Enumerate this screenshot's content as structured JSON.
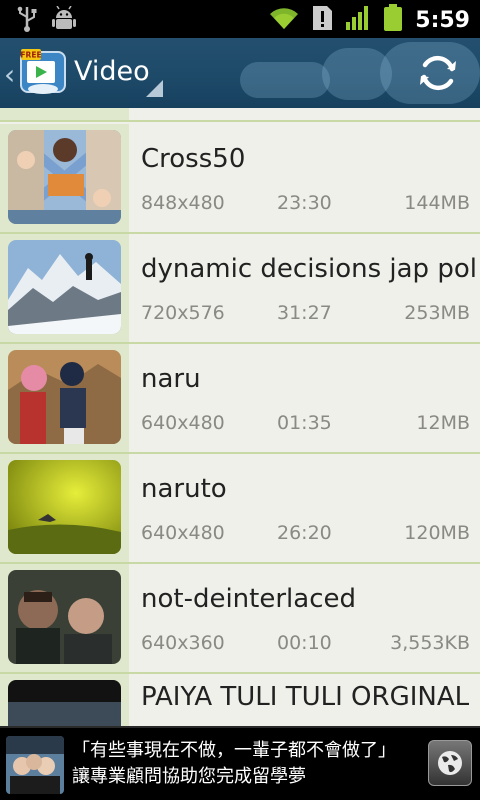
{
  "status_bar": {
    "time": "5:59",
    "icons": [
      "usb-icon",
      "android-debug-icon",
      "wifi-icon",
      "sd-card-alert-icon",
      "signal-icon",
      "battery-icon"
    ],
    "accent": "#9acd32"
  },
  "header": {
    "title": "Video",
    "app_icon": "free-video-app-icon",
    "app_icon_badge": "FREE",
    "refresh_icon": "refresh-icon",
    "background": "#1e4a69"
  },
  "videos": [
    {
      "name": "Cross50",
      "resolution": "848x480",
      "duration": "23:30",
      "size": "144MB"
    },
    {
      "name": "dynamic decisions jap pol",
      "resolution": "720x576",
      "duration": "31:27",
      "size": "253MB"
    },
    {
      "name": "naru",
      "resolution": "640x480",
      "duration": "01:35",
      "size": "12MB"
    },
    {
      "name": "naruto",
      "resolution": "640x480",
      "duration": "26:20",
      "size": "120MB"
    },
    {
      "name": "not-deinterlaced",
      "resolution": "640x360",
      "duration": "00:10",
      "size": "3,553KB"
    },
    {
      "name": "PAIYA TULI TULI ORGINAL",
      "resolution": "",
      "duration": "",
      "size": ""
    }
  ],
  "ad": {
    "text": "「有些事現在不做，一輩子都不會做了」讓專業顧問協助您完成留學夢",
    "icon": "globe-icon"
  }
}
